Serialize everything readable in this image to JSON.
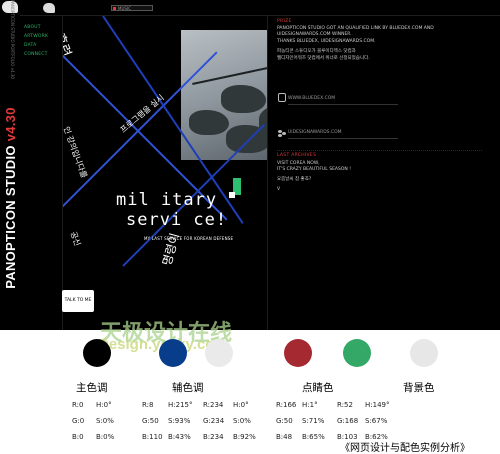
{
  "app": {
    "logo": "PANOPTICON STUDIO",
    "version": "v4.30",
    "music_label": "MUSIC",
    "nav": [
      "ABOUT",
      "ARTWORK",
      "DATA",
      "CONNECT"
    ]
  },
  "art": {
    "title_line1": "mil itary",
    "title_line2": "servi ce!",
    "subtitle": "MY LAST SERVICE FOR KOREAN DEFENSE",
    "kor1": "훈련",
    "kor2": "인 강의입니다를",
    "kor3": "프로그램을 실시",
    "kor4": "공신",
    "kor5": "명령이",
    "talk_btn": "TALK TO ME"
  },
  "right": {
    "sec1_title": "PRIZE",
    "sec1_en": "PANOPTICON STUDIO GOT AN QUALIFIED LINK BY BLUEDEX.COM AND UIDESIGNAWARDS.COM WINNER.",
    "sec1_thanks": "THANKS BLUEDEX, UIDESIGNAWARDS.COM.",
    "sec1_kor1": "파놉티콘 스튜디오가 블루이디엑스 닷컴과",
    "sec1_kor2": "웹디자인어워즈 닷컴에서 위너로 선정되었습니다.",
    "link1": "WWW.BLUEDEX.COM",
    "link2": "UIDESIGNAWARDS.COM",
    "sec2_title": "LAST ARCHIVES",
    "sec2_en1": "VISIT COREA NOW,",
    "sec2_en2": "IT'S CRAZY BEAUTIFUL SEASON !",
    "sec2_kor": "요즘날씨 참 좋죠?",
    "sec2_mark": "V"
  },
  "watermark": {
    "cn": "天极设计在线",
    "en": "Design.yesky.com"
  },
  "palette": {
    "groups": [
      "主色调",
      "辅色调",
      "点睛色",
      "背景色"
    ],
    "colors": [
      "#000000",
      "#083d8c",
      "#eaeaea",
      "#a52930",
      "#34a867",
      "#e7e7e7"
    ],
    "col1": [
      "R:0",
      "G:0",
      "B:0"
    ],
    "col2": [
      "H:0°",
      "S:0%",
      "B:0%"
    ],
    "col3": [
      "R:8",
      "G:50",
      "B:110"
    ],
    "col4": [
      "H:215°",
      "S:93%",
      "B:43%"
    ],
    "col5": [
      "R:234",
      "G:234",
      "B:234"
    ],
    "col6": [
      "H:0°",
      "S:0%",
      "B:92%"
    ],
    "col7": [
      "R:166",
      "G:50",
      "B:48"
    ],
    "col8": [
      "H:1°",
      "S:71%",
      "B:65%"
    ],
    "col9": [
      "R:52",
      "G:168",
      "B:103"
    ],
    "col10": [
      "H:149°",
      "S:67%",
      "B:62%"
    ]
  },
  "caption": "《网页设计与配色实例分析》"
}
